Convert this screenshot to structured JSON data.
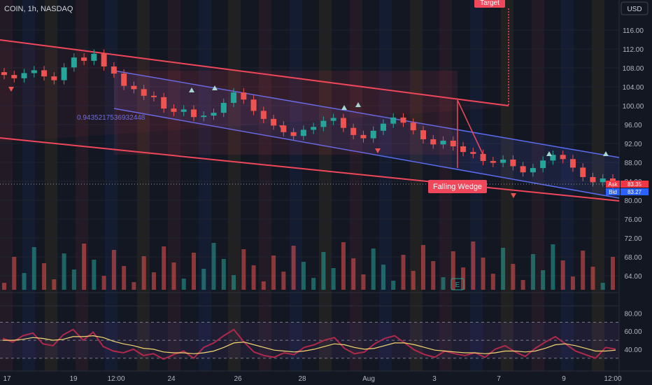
{
  "header": {
    "symbol": "COIN, 1h, NASDAQ",
    "currency": "USD"
  },
  "annotations": {
    "target": "Target",
    "pattern": "Falling Wedge",
    "fib_value": "0.9435217536932448",
    "ask_label": "Ask",
    "ask_value": "83.35",
    "bid_label": "Bid",
    "bid_value": "83.27",
    "volume_badge": "E"
  },
  "price_axis": [
    "116.00",
    "112.00",
    "108.00",
    "104.00",
    "100.00",
    "96.00",
    "92.00",
    "88.00",
    "84.00",
    "80.00",
    "76.00",
    "72.00",
    "68.00",
    "64.00"
  ],
  "rsi_axis": [
    "80.00",
    "60.00",
    "40.00"
  ],
  "time_axis": [
    "17",
    "19",
    "12:00",
    "24",
    "26",
    "28",
    "Aug",
    "3",
    "7",
    "9",
    "12:00"
  ],
  "colors": {
    "background": "#131722",
    "up": "#26a69a",
    "down": "#ef5350",
    "channel_blue": "#5b6cf0",
    "wedge_red": "#f0475a",
    "rsi_line": "#b0284a",
    "rsi_signal": "#f5d76e",
    "ask": "#f23645",
    "bid": "#2962ff"
  },
  "chart_data": {
    "type": "candlestick",
    "title": "COIN, 1h, NASDAQ",
    "ylim": [
      62,
      120
    ],
    "close_series": [
      106.5,
      105.8,
      106.9,
      107.5,
      106.2,
      105.4,
      108.1,
      110.2,
      109.5,
      111.0,
      108.3,
      106.8,
      104.2,
      103.5,
      102.1,
      101.8,
      99.4,
      98.7,
      99.2,
      97.6,
      97.9,
      98.5,
      100.6,
      102.8,
      101.3,
      98.9,
      97.2,
      95.8,
      94.4,
      93.6,
      94.9,
      95.5,
      96.8,
      97.4,
      95.3,
      93.8,
      93.1,
      94.7,
      96.2,
      97.5,
      96.4,
      94.8,
      92.9,
      91.8,
      92.6,
      91.4,
      90.2,
      89.8,
      88.3,
      87.9,
      88.6,
      87.2,
      85.9,
      86.8,
      88.4,
      89.6,
      88.7,
      86.9,
      84.9,
      83.8,
      84.6,
      83.3
    ],
    "rsi": {
      "levels": [
        70,
        50,
        30
      ],
      "ylim": [
        22,
        82
      ],
      "values": [
        52,
        48,
        55,
        58,
        46,
        44,
        56,
        62,
        50,
        59,
        43,
        38,
        36,
        40,
        33,
        35,
        29,
        34,
        38,
        30,
        42,
        47,
        55,
        62,
        48,
        37,
        33,
        31,
        36,
        34,
        42,
        45,
        50,
        53,
        41,
        35,
        37,
        46,
        52,
        55,
        47,
        39,
        34,
        31,
        38,
        35,
        33,
        36,
        31,
        40,
        44,
        37,
        32,
        41,
        48,
        54,
        46,
        38,
        34,
        30,
        42,
        40
      ],
      "signal": [
        50,
        50,
        51,
        53,
        52,
        50,
        51,
        54,
        54,
        55,
        53,
        49,
        46,
        44,
        41,
        40,
        37,
        36,
        36,
        35,
        36,
        38,
        42,
        47,
        48,
        45,
        42,
        39,
        38,
        37,
        38,
        40,
        43,
        46,
        45,
        42,
        40,
        41,
        44,
        47,
        47,
        45,
        42,
        39,
        38,
        37,
        36,
        36,
        35,
        36,
        38,
        38,
        37,
        38,
        41,
        45,
        46,
        44,
        41,
        38,
        38,
        39
      ]
    }
  }
}
